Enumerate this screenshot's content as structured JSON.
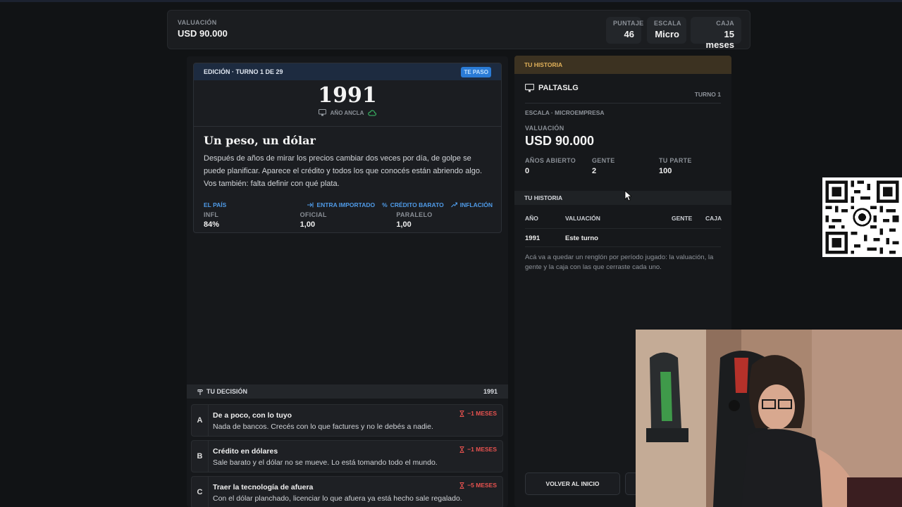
{
  "header": {
    "valuation_label": "VALUACIÓN",
    "valuation_value": "USD 90.000",
    "stats": [
      {
        "label": "PUNTAJE",
        "value": "46"
      },
      {
        "label": "ESCALA",
        "value": "Micro"
      },
      {
        "label": "CAJA",
        "value": "15 meses"
      }
    ]
  },
  "event_card": {
    "edition_label": "EDICIÓN · TURNO 1 DE 29",
    "badge": "TE PASO",
    "year": "1991",
    "anchor_label": "AÑO ANCLA",
    "title": "Un peso, un dólar",
    "description": "Después de años de mirar los precios cambiar dos veces por día, de golpe se puede planificar. Aparece el crédito y todos los que conocés están abriendo algo. Vos también: falta definir con qué plata.",
    "country_label": "EL PAÍS",
    "tags": [
      "ENTRA IMPORTADO",
      "CRÉDITO BARATO",
      "INFLACIÓN"
    ],
    "indicators": [
      {
        "label": "INFL",
        "value": "84%"
      },
      {
        "label": "OFICIAL",
        "value": "1,00"
      },
      {
        "label": "PARALELO",
        "value": "1,00"
      }
    ]
  },
  "decision": {
    "title": "TU DECISIÓN",
    "year": "1991",
    "options": [
      {
        "letter": "A",
        "title": "De a poco, con lo tuyo",
        "desc": "Nada de bancos. Crecés con lo que factures y no le debés a nadie.",
        "cost": "−1 MESES"
      },
      {
        "letter": "B",
        "title": "Crédito en dólares",
        "desc": "Sale barato y el dólar no se mueve. Lo está tomando todo el mundo.",
        "cost": "−1 MESES"
      },
      {
        "letter": "C",
        "title": "Traer la tecnología de afuera",
        "desc": "Con el dólar planchado, licenciar lo que afuera ya está hecho sale regalado.",
        "cost": "−5 MESES"
      }
    ]
  },
  "history_panel": {
    "header": "TU HISTORIA",
    "player_name": "PALTASLG",
    "turn": "TURNO 1",
    "scale": "ESCALA · MICROEMPRESA",
    "valuation_label": "VALUACIÓN",
    "valuation_value": "USD 90.000",
    "stats": [
      {
        "label": "AÑOS ABIERTO",
        "value": "0"
      },
      {
        "label": "GENTE",
        "value": "2"
      },
      {
        "label": "TU PARTE",
        "value": "100"
      }
    ],
    "history_title": "TU HISTORIA",
    "columns": [
      "AÑO",
      "VALUACIÓN",
      "GENTE",
      "CAJA"
    ],
    "rows": [
      {
        "year": "1991",
        "valuation": "Este turno",
        "people": "",
        "cash": ""
      }
    ],
    "note": "Acá va a quedar un renglón por período jugado: la valuación, la gente y la caja con las que cerraste cada uno.",
    "home_button": "VOLVER AL INICIO"
  },
  "colors": {
    "accent_blue": "#4f9be8",
    "cost_red": "#e8524f",
    "history_gold": "#e2b25a"
  }
}
